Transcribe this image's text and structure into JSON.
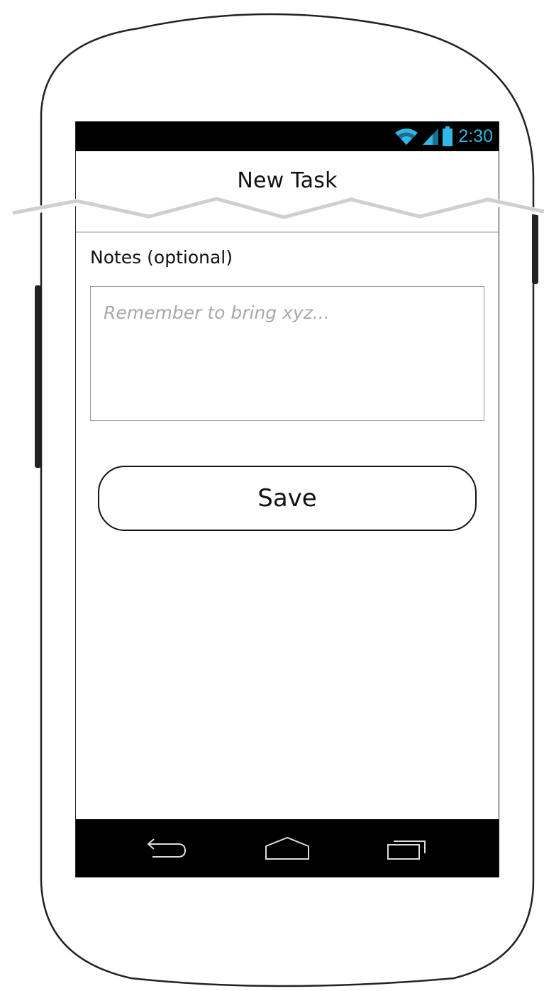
{
  "status_bar": {
    "time": "2:30",
    "accent_color": "#33b5e5",
    "icons": [
      "wifi-icon",
      "signal-icon",
      "battery-icon"
    ]
  },
  "header": {
    "title": "New Task"
  },
  "form": {
    "notes_label": "Notes (optional)",
    "notes_placeholder": "Remember to bring xyz...",
    "notes_value": ""
  },
  "actions": {
    "save_label": "Save"
  },
  "nav_bar": {
    "buttons": [
      "back-icon",
      "home-icon",
      "recent-apps-icon"
    ]
  }
}
